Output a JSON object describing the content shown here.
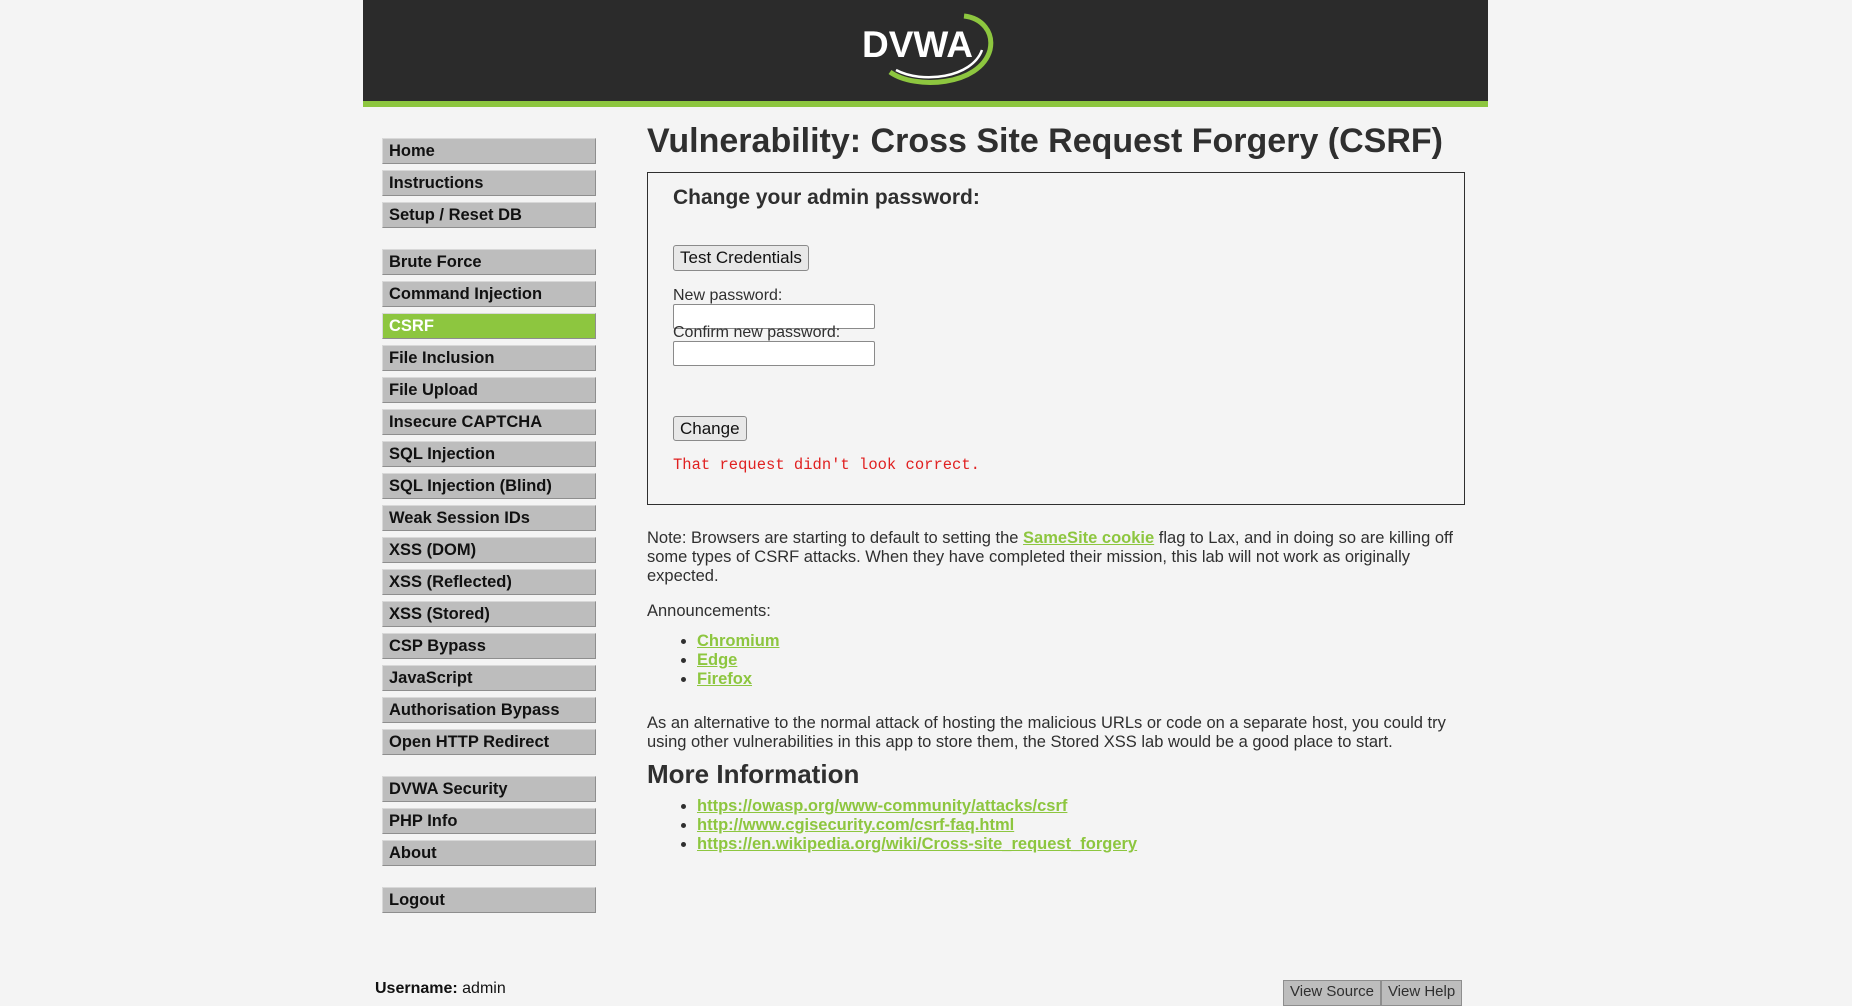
{
  "header": {
    "logo_text": "DVWA"
  },
  "menu": {
    "blocks": [
      [
        "Home",
        "Instructions",
        "Setup / Reset DB"
      ],
      [
        "Brute Force",
        "Command Injection",
        "CSRF",
        "File Inclusion",
        "File Upload",
        "Insecure CAPTCHA",
        "SQL Injection",
        "SQL Injection (Blind)",
        "Weak Session IDs",
        "XSS (DOM)",
        "XSS (Reflected)",
        "XSS (Stored)",
        "CSP Bypass",
        "JavaScript",
        "Authorisation Bypass",
        "Open HTTP Redirect"
      ],
      [
        "DVWA Security",
        "PHP Info",
        "About"
      ],
      [
        "Logout"
      ]
    ],
    "selected": "CSRF"
  },
  "page": {
    "title": "Vulnerability: Cross Site Request Forgery (CSRF)",
    "box_heading": "Change your admin password:",
    "test_button": "Test Credentials",
    "new_password_label": "New password:",
    "confirm_password_label": "Confirm new password:",
    "new_password_value": "",
    "confirm_password_value": "",
    "change_button": "Change",
    "error": "That request didn't look correct.",
    "note_before": "Note: Browsers are starting to default to setting the ",
    "note_link": "SameSite cookie",
    "note_after": " flag to Lax, and in doing so are killing off some types of CSRF attacks. When they have completed their mission, this lab will not work as originally expected.",
    "announcements_label": "Announcements:",
    "announcements": [
      "Chromium",
      "Edge",
      "Firefox"
    ],
    "alternative": "As an alternative to the normal attack of hosting the malicious URLs or code on a separate host, you could try using other vulnerabilities in this app to store them, the Stored XSS lab would be a good place to start.",
    "more_info_heading": "More Information",
    "more_info_links": [
      "https://owasp.org/www-community/attacks/csrf",
      "http://www.cgisecurity.com/csrf-faq.html",
      "https://en.wikipedia.org/wiki/Cross-site_request_forgery"
    ]
  },
  "footer": {
    "username_label": "Username:",
    "username": "admin",
    "view_source": "View Source",
    "view_help": "View Help"
  },
  "colors": {
    "accent": "#8dc63f",
    "header_bg": "#2b2b2b",
    "error": "#e02020"
  }
}
